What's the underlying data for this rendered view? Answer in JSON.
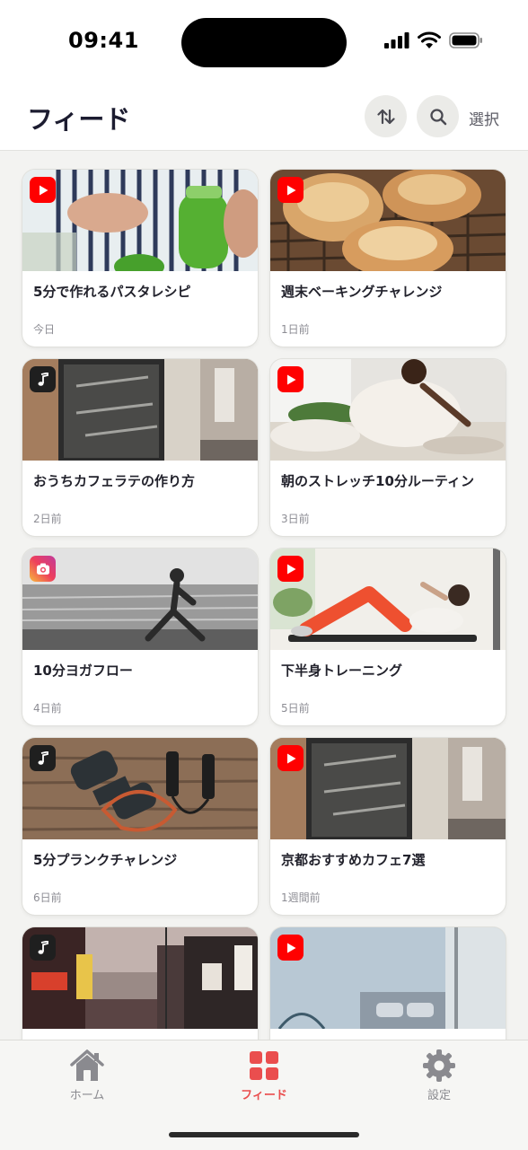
{
  "status_bar": {
    "time": "09:41"
  },
  "header": {
    "title": "フィード",
    "select_label": "選択"
  },
  "colors": {
    "accent": "#ea4e4e",
    "youtube": "#ff0000",
    "music": "#1f1f1f"
  },
  "feed": {
    "items": [
      {
        "title": "5分で作れるパスタレシピ",
        "date": "今日",
        "source": "youtube-icon",
        "thumbnail": "pesto-jar-photo"
      },
      {
        "title": "週末ベーキングチャレンジ",
        "date": "1日前",
        "source": "youtube-icon",
        "thumbnail": "bread-loaves-photo"
      },
      {
        "title": "おうちカフェラテの作り方",
        "date": "2日前",
        "source": "music-note-icon",
        "thumbnail": "cafe-window-photo"
      },
      {
        "title": "朝のストレッチ10分ルーティン",
        "date": "3日前",
        "source": "youtube-icon",
        "thumbnail": "bed-stretch-photo"
      },
      {
        "title": "10分ヨガフロー",
        "date": "4日前",
        "source": "instagram-icon",
        "thumbnail": "beach-yoga-photo"
      },
      {
        "title": "下半身トレーニング",
        "date": "5日前",
        "source": "youtube-icon",
        "thumbnail": "crunch-workout-photo"
      },
      {
        "title": "5分プランクチャレンジ",
        "date": "6日前",
        "source": "music-note-icon",
        "thumbnail": "dumbbells-photo"
      },
      {
        "title": "京都おすすめカフェ7選",
        "date": "1週間前",
        "source": "youtube-icon",
        "thumbnail": "cafe-window-photo"
      },
      {
        "title": "",
        "date": "",
        "source": "music-note-icon",
        "thumbnail": "neon-street-photo"
      },
      {
        "title": "",
        "date": "",
        "source": "youtube-icon",
        "thumbnail": "bedroom-photo"
      }
    ]
  },
  "tab_bar": {
    "tabs": [
      {
        "label": "ホーム",
        "icon": "house-icon",
        "active": false
      },
      {
        "label": "フィード",
        "icon": "grid-icon",
        "active": true
      },
      {
        "label": "設定",
        "icon": "gear-icon",
        "active": false
      }
    ]
  }
}
